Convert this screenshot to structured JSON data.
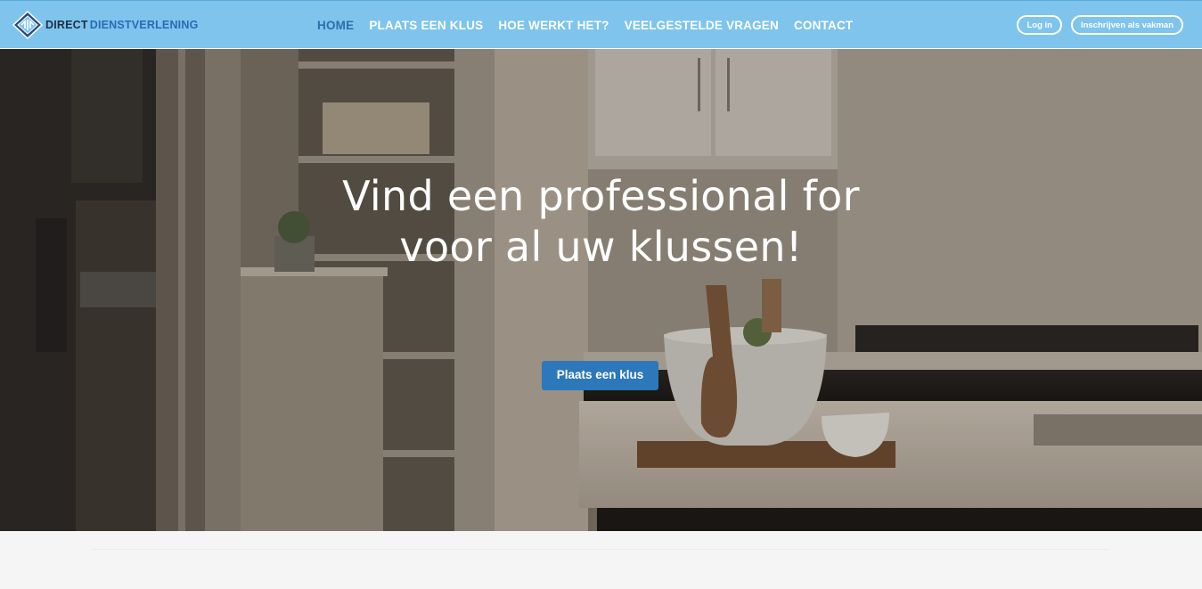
{
  "brand": {
    "name_part1": "DIRECT",
    "name_part2": "DIENSTVERLENING"
  },
  "nav": {
    "items": [
      {
        "label": "HOME",
        "active": true
      },
      {
        "label": "PLAATS EEN KLUS",
        "active": false
      },
      {
        "label": "HOE WERKT HET?",
        "active": false
      },
      {
        "label": "VEELGESTELDE VRAGEN",
        "active": false
      },
      {
        "label": "CONTACT",
        "active": false
      }
    ]
  },
  "auth": {
    "login_label": "Log in",
    "register_label": "Inschrijven als vakman"
  },
  "hero": {
    "title_line1": "Vind een professional for",
    "title_line2": "voor al uw klussen!",
    "cta_label": "Plaats een klus"
  },
  "colors": {
    "navbar": "#7ec4ed",
    "nav_active": "#2e6ea8",
    "cta": "#2d77bb",
    "brand_dark": "#1f2e46",
    "brand_blue": "#2f68b4"
  }
}
